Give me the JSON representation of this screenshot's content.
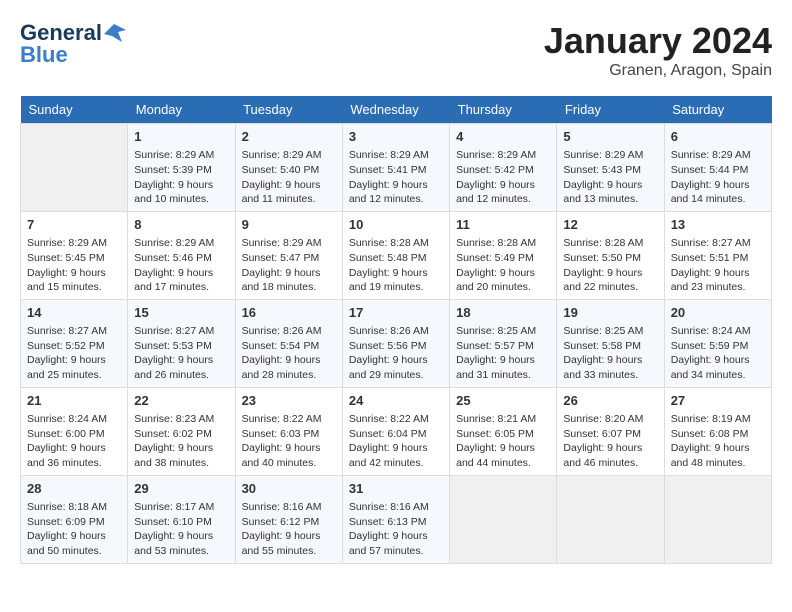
{
  "header": {
    "logo_line1": "General",
    "logo_line2": "Blue",
    "month_title": "January 2024",
    "location": "Granen, Aragon, Spain"
  },
  "columns": [
    "Sunday",
    "Monday",
    "Tuesday",
    "Wednesday",
    "Thursday",
    "Friday",
    "Saturday"
  ],
  "days": [
    {
      "day": null
    },
    {
      "day": 1,
      "sunrise": "Sunrise: 8:29 AM",
      "sunset": "Sunset: 5:39 PM",
      "daylight": "Daylight: 9 hours and 10 minutes."
    },
    {
      "day": 2,
      "sunrise": "Sunrise: 8:29 AM",
      "sunset": "Sunset: 5:40 PM",
      "daylight": "Daylight: 9 hours and 11 minutes."
    },
    {
      "day": 3,
      "sunrise": "Sunrise: 8:29 AM",
      "sunset": "Sunset: 5:41 PM",
      "daylight": "Daylight: 9 hours and 12 minutes."
    },
    {
      "day": 4,
      "sunrise": "Sunrise: 8:29 AM",
      "sunset": "Sunset: 5:42 PM",
      "daylight": "Daylight: 9 hours and 12 minutes."
    },
    {
      "day": 5,
      "sunrise": "Sunrise: 8:29 AM",
      "sunset": "Sunset: 5:43 PM",
      "daylight": "Daylight: 9 hours and 13 minutes."
    },
    {
      "day": 6,
      "sunrise": "Sunrise: 8:29 AM",
      "sunset": "Sunset: 5:44 PM",
      "daylight": "Daylight: 9 hours and 14 minutes."
    },
    {
      "day": 7,
      "sunrise": "Sunrise: 8:29 AM",
      "sunset": "Sunset: 5:45 PM",
      "daylight": "Daylight: 9 hours and 15 minutes."
    },
    {
      "day": 8,
      "sunrise": "Sunrise: 8:29 AM",
      "sunset": "Sunset: 5:46 PM",
      "daylight": "Daylight: 9 hours and 17 minutes."
    },
    {
      "day": 9,
      "sunrise": "Sunrise: 8:29 AM",
      "sunset": "Sunset: 5:47 PM",
      "daylight": "Daylight: 9 hours and 18 minutes."
    },
    {
      "day": 10,
      "sunrise": "Sunrise: 8:28 AM",
      "sunset": "Sunset: 5:48 PM",
      "daylight": "Daylight: 9 hours and 19 minutes."
    },
    {
      "day": 11,
      "sunrise": "Sunrise: 8:28 AM",
      "sunset": "Sunset: 5:49 PM",
      "daylight": "Daylight: 9 hours and 20 minutes."
    },
    {
      "day": 12,
      "sunrise": "Sunrise: 8:28 AM",
      "sunset": "Sunset: 5:50 PM",
      "daylight": "Daylight: 9 hours and 22 minutes."
    },
    {
      "day": 13,
      "sunrise": "Sunrise: 8:27 AM",
      "sunset": "Sunset: 5:51 PM",
      "daylight": "Daylight: 9 hours and 23 minutes."
    },
    {
      "day": 14,
      "sunrise": "Sunrise: 8:27 AM",
      "sunset": "Sunset: 5:52 PM",
      "daylight": "Daylight: 9 hours and 25 minutes."
    },
    {
      "day": 15,
      "sunrise": "Sunrise: 8:27 AM",
      "sunset": "Sunset: 5:53 PM",
      "daylight": "Daylight: 9 hours and 26 minutes."
    },
    {
      "day": 16,
      "sunrise": "Sunrise: 8:26 AM",
      "sunset": "Sunset: 5:54 PM",
      "daylight": "Daylight: 9 hours and 28 minutes."
    },
    {
      "day": 17,
      "sunrise": "Sunrise: 8:26 AM",
      "sunset": "Sunset: 5:56 PM",
      "daylight": "Daylight: 9 hours and 29 minutes."
    },
    {
      "day": 18,
      "sunrise": "Sunrise: 8:25 AM",
      "sunset": "Sunset: 5:57 PM",
      "daylight": "Daylight: 9 hours and 31 minutes."
    },
    {
      "day": 19,
      "sunrise": "Sunrise: 8:25 AM",
      "sunset": "Sunset: 5:58 PM",
      "daylight": "Daylight: 9 hours and 33 minutes."
    },
    {
      "day": 20,
      "sunrise": "Sunrise: 8:24 AM",
      "sunset": "Sunset: 5:59 PM",
      "daylight": "Daylight: 9 hours and 34 minutes."
    },
    {
      "day": 21,
      "sunrise": "Sunrise: 8:24 AM",
      "sunset": "Sunset: 6:00 PM",
      "daylight": "Daylight: 9 hours and 36 minutes."
    },
    {
      "day": 22,
      "sunrise": "Sunrise: 8:23 AM",
      "sunset": "Sunset: 6:02 PM",
      "daylight": "Daylight: 9 hours and 38 minutes."
    },
    {
      "day": 23,
      "sunrise": "Sunrise: 8:22 AM",
      "sunset": "Sunset: 6:03 PM",
      "daylight": "Daylight: 9 hours and 40 minutes."
    },
    {
      "day": 24,
      "sunrise": "Sunrise: 8:22 AM",
      "sunset": "Sunset: 6:04 PM",
      "daylight": "Daylight: 9 hours and 42 minutes."
    },
    {
      "day": 25,
      "sunrise": "Sunrise: 8:21 AM",
      "sunset": "Sunset: 6:05 PM",
      "daylight": "Daylight: 9 hours and 44 minutes."
    },
    {
      "day": 26,
      "sunrise": "Sunrise: 8:20 AM",
      "sunset": "Sunset: 6:07 PM",
      "daylight": "Daylight: 9 hours and 46 minutes."
    },
    {
      "day": 27,
      "sunrise": "Sunrise: 8:19 AM",
      "sunset": "Sunset: 6:08 PM",
      "daylight": "Daylight: 9 hours and 48 minutes."
    },
    {
      "day": 28,
      "sunrise": "Sunrise: 8:18 AM",
      "sunset": "Sunset: 6:09 PM",
      "daylight": "Daylight: 9 hours and 50 minutes."
    },
    {
      "day": 29,
      "sunrise": "Sunrise: 8:17 AM",
      "sunset": "Sunset: 6:10 PM",
      "daylight": "Daylight: 9 hours and 53 minutes."
    },
    {
      "day": 30,
      "sunrise": "Sunrise: 8:16 AM",
      "sunset": "Sunset: 6:12 PM",
      "daylight": "Daylight: 9 hours and 55 minutes."
    },
    {
      "day": 31,
      "sunrise": "Sunrise: 8:16 AM",
      "sunset": "Sunset: 6:13 PM",
      "daylight": "Daylight: 9 hours and 57 minutes."
    },
    {
      "day": null
    },
    {
      "day": null
    },
    {
      "day": null
    }
  ]
}
